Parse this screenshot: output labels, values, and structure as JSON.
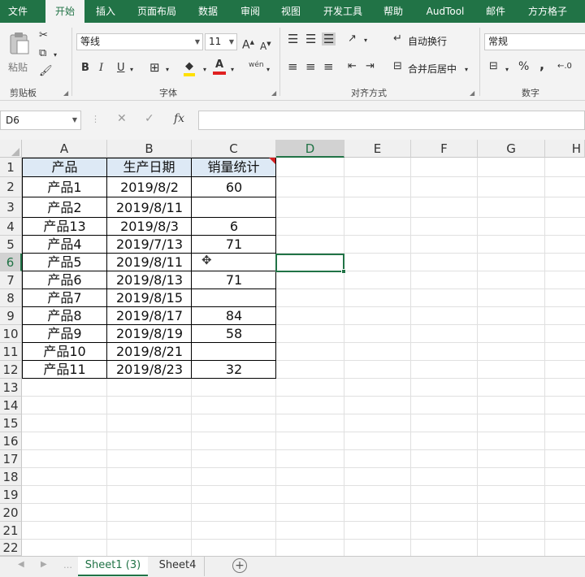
{
  "ribbon_tabs": [
    "文件",
    "开始",
    "插入",
    "页面布局",
    "数据",
    "审阅",
    "视图",
    "开发工具",
    "帮助",
    "AudTool",
    "邮件",
    "方方格子"
  ],
  "active_tab": "开始",
  "clipboard": {
    "paste_label": "粘贴",
    "group_label": "剪贴板"
  },
  "font": {
    "name": "等线",
    "size": "11",
    "bold": "B",
    "italic": "I",
    "underline": "U",
    "group_label": "字体",
    "phonetic": "wén"
  },
  "alignment": {
    "wrap_text": "自动换行",
    "merge_center": "合并后居中",
    "group_label": "对齐方式"
  },
  "number": {
    "format": "常规",
    "percent": "%",
    "comma": ",",
    "group_label": "数字"
  },
  "formula_bar": {
    "name_box": "D6",
    "fx": "fx",
    "formula": ""
  },
  "columns": [
    "A",
    "B",
    "C",
    "D",
    "E",
    "F",
    "G",
    "H"
  ],
  "selected_column": "D",
  "selected_row": "6",
  "rows": [
    "1",
    "2",
    "3",
    "4",
    "5",
    "6",
    "7",
    "8",
    "9",
    "10",
    "11",
    "12",
    "13",
    "14",
    "15",
    "16",
    "17",
    "18",
    "19",
    "20",
    "21",
    "22"
  ],
  "table": {
    "headers": [
      "产品",
      "生产日期",
      "销量统计"
    ],
    "data": [
      [
        "产品1",
        "2019/8/2",
        "60"
      ],
      [
        "产品2",
        "2019/8/11",
        ""
      ],
      [
        "产品13",
        "2019/8/3",
        "6"
      ],
      [
        "产品4",
        "2019/7/13",
        "71"
      ],
      [
        "产品5",
        "2019/8/11",
        ""
      ],
      [
        "产品6",
        "2019/8/13",
        "71"
      ],
      [
        "产品7",
        "2019/8/15",
        ""
      ],
      [
        "产品8",
        "2019/8/17",
        "84"
      ],
      [
        "产品9",
        "2019/8/19",
        "58"
      ],
      [
        "产品10",
        "2019/8/21",
        ""
      ],
      [
        "产品11",
        "2019/8/23",
        "32"
      ]
    ]
  },
  "sheets": [
    "Sheet1 (3)",
    "Sheet4"
  ],
  "active_sheet": "Sheet1 (3)",
  "colors": {
    "accent": "#217346",
    "header_fill": "#dde9f5",
    "comment_marker": "#d42020"
  }
}
